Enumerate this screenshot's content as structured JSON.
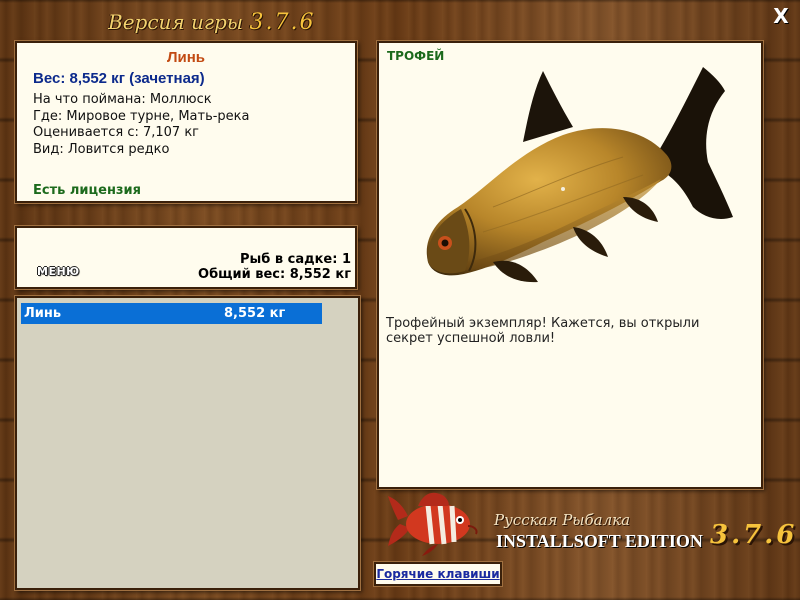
{
  "window": {
    "title_prefix": "Версия игры",
    "title_version": "3.7.6",
    "close_label": "X"
  },
  "fish_info": {
    "name": "Линь",
    "weight_line": "Вес: 8,552 кг (зачетная)",
    "caught_on": "На что поймана: Моллюск",
    "location": "Где: Мировое турне, Мать-река",
    "value": "Оценивается с: 7,107 кг",
    "rarity": "Вид: Ловится редко",
    "license": "Есть лицензия"
  },
  "summary": {
    "menu_label": "МЕНЮ",
    "fish_count": "Рыб в садке: 1",
    "total_weight": "Общий вес: 8,552 кг"
  },
  "catch_list": [
    {
      "name": "Линь",
      "weight": "8,552 кг",
      "selected": true
    }
  ],
  "trophy": {
    "label": "ТРОФЕЙ",
    "fish_icon": "tench-fish-illustration",
    "description": "Трофейный экземпляр! Кажется, вы открыли секрет успешной ловли!"
  },
  "logo": {
    "line1": "Русская Рыбалка",
    "line2": "INSTALLSOFT EDITION",
    "version": "3.7.6",
    "icon": "striped-fish-logo-icon"
  },
  "hotkeys_label": "Горячие клавиши",
  "colors": {
    "fish_name": "#c24a12",
    "weight": "#0c2a8c",
    "license": "#1c6a1c",
    "selection": "#0a6fd6",
    "title": "#f3d26f"
  }
}
